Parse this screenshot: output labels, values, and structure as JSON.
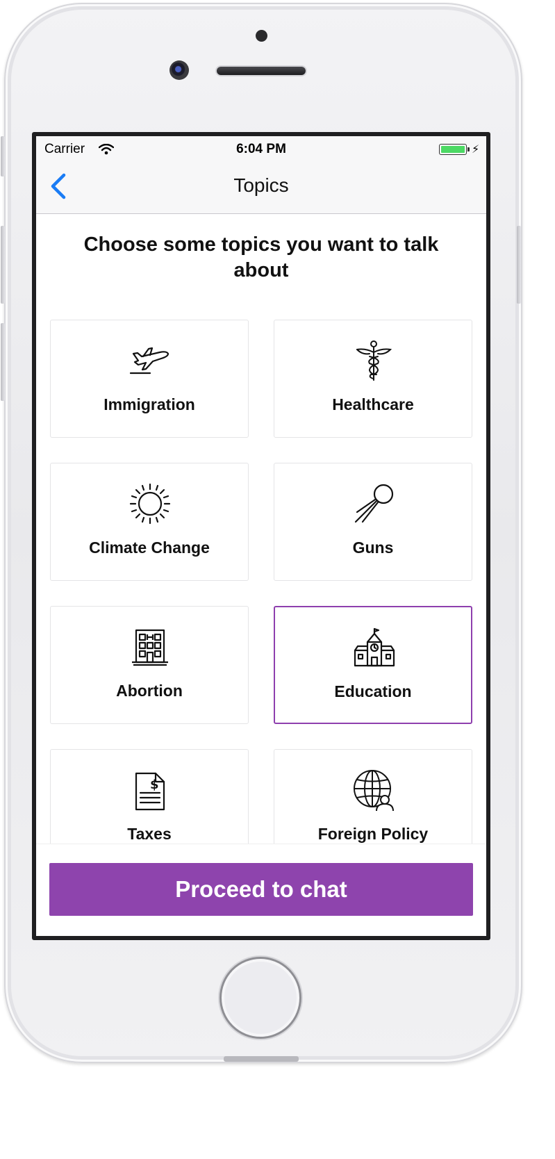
{
  "status_bar": {
    "carrier": "Carrier",
    "time": "6:04 PM"
  },
  "navbar": {
    "title": "Topics",
    "back_icon": "chevron-left-icon"
  },
  "headline": "Choose some topics you want to talk about",
  "topics": [
    {
      "label": "Immigration",
      "icon": "airplane-icon",
      "selected": false
    },
    {
      "label": "Healthcare",
      "icon": "caduceus-icon",
      "selected": false
    },
    {
      "label": "Climate Change",
      "icon": "sun-icon",
      "selected": false
    },
    {
      "label": "Guns",
      "icon": "satellite-icon",
      "selected": false
    },
    {
      "label": "Abortion",
      "icon": "building-icon",
      "selected": false
    },
    {
      "label": "Education",
      "icon": "school-icon",
      "selected": true
    },
    {
      "label": "Taxes",
      "icon": "tax-document-icon",
      "selected": false
    },
    {
      "label": "Foreign Policy",
      "icon": "globe-person-icon",
      "selected": false
    }
  ],
  "proceed_button": {
    "label": "Proceed to chat"
  },
  "colors": {
    "accent": "#8e44ad",
    "ios_blue": "#1a7cf5",
    "battery": "#4cd964"
  }
}
